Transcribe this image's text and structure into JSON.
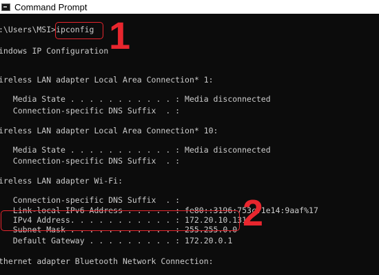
{
  "window": {
    "title": "Command Prompt",
    "icon": "cmd-icon"
  },
  "console": {
    "prompt": ":\\Users\\MSI>",
    "command": "ipconfig",
    "lines": [
      "indows IP Configuration",
      "ireless LAN adapter Local Area Connection* 1:",
      "   Media State . . . . . . . . . . . : Media disconnected",
      "   Connection-specific DNS Suffix  . :",
      "ireless LAN adapter Local Area Connection* 10:",
      "   Media State . . . . . . . . . . . : Media disconnected",
      "   Connection-specific DNS Suffix  . :",
      "ireless LAN adapter Wi-Fi:",
      "   Connection-specific DNS Suffix  . :",
      "   Link-local IPv6 Address . . . . . : fe80::3196:753c:1e14:9aaf%17",
      "   IPv4 Address. . . . . . . . . . . : 172.20.10.131",
      "   Subnet Mask . . . . . . . . . . . : 255.255.0.0",
      "   Default Gateway . . . . . . . . . : 172.20.0.1",
      "thernet adapter Bluetooth Network Connection:"
    ]
  },
  "annotations": {
    "step1": "1",
    "step2": "2",
    "color": "#e8262e"
  }
}
